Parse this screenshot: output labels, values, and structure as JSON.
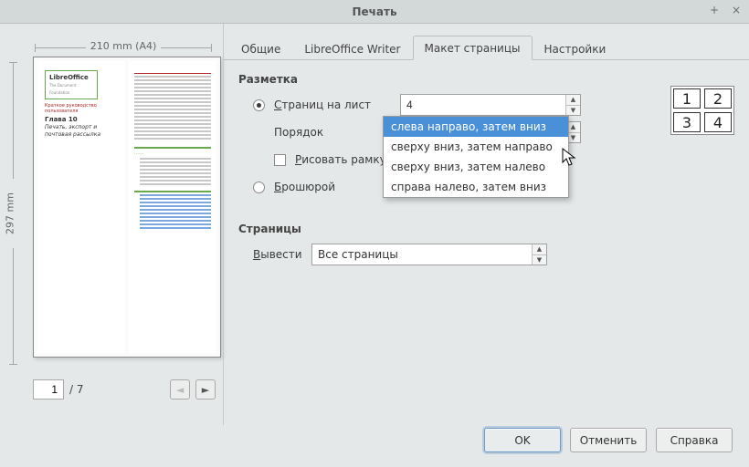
{
  "window": {
    "title": "Печать",
    "max_icon": "+",
    "close_icon": "×"
  },
  "preview": {
    "width_label": "210 mm (A4)",
    "height_label": "297 mm",
    "logo_main": "LibreOffice",
    "logo_sub": "The Document Foundation",
    "red_text": "Краткое руководство пользователя",
    "chapter": "Глава 10",
    "chapter_sub1": "Печать, экспорт и",
    "chapter_sub2": "почтовая рассылка"
  },
  "pager": {
    "current": "1",
    "total_label": "/ 7",
    "prev": "◄",
    "next": "►"
  },
  "tabs": [
    {
      "label": "Общие"
    },
    {
      "label": "LibreOffice Writer"
    },
    {
      "label": "Макет страницы"
    },
    {
      "label": "Настройки"
    }
  ],
  "active_tab_index": 2,
  "layout": {
    "section": "Разметка",
    "pages_per_sheet_radio_pre": "С",
    "pages_per_sheet_radio_rest": "траниц на лист",
    "pages_per_sheet_value": "4",
    "order_label": "Порядок",
    "order_value": "слева направо, затем вниз",
    "order_options": [
      "слева направо, затем вниз",
      "сверху вниз, затем направо",
      "сверху вниз, затем налево",
      "справа налево, затем вниз"
    ],
    "draw_border_pre": "Р",
    "draw_border_rest": "исовать рамку в",
    "brochure_pre": "Б",
    "brochure_rest": "рошюрой",
    "grid": [
      "1",
      "2",
      "3",
      "4"
    ]
  },
  "pages": {
    "section": "Страницы",
    "output_label_pre": "В",
    "output_label_rest": "ывести",
    "output_value": "Все страницы"
  },
  "buttons": {
    "ok": "OK",
    "cancel": "Отменить",
    "help": "Справка"
  }
}
